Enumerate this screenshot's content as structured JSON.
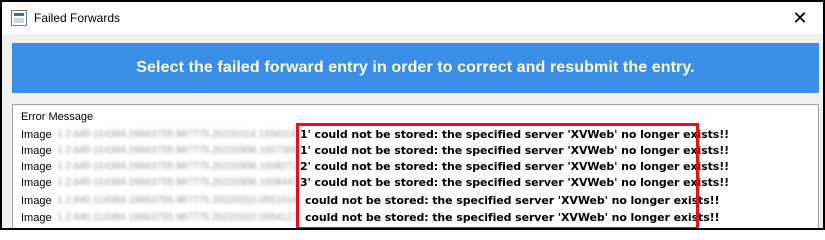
{
  "window": {
    "title": "Failed Forwards",
    "close_glyph": "✕"
  },
  "banner": {
    "text": "Select the failed forward entry in order to correct and resubmit the entry."
  },
  "list": {
    "column_header": "Error Message",
    "rows": [
      {
        "prefix": "Image",
        "uid": "1.2.840.114384.16663755.987775.20220114.1334116",
        "message": "1' could not be stored: the specified server 'XVWeb' no longer exists!!"
      },
      {
        "prefix": "Image",
        "uid": "1.2.840.114384.16663755.987775.20220306.1607369",
        "message": "1' could not be stored: the specified server 'XVWeb' no longer exists!!"
      },
      {
        "prefix": "Image",
        "uid": "1.2.840.114384.16663755.987775.20220306.1608272",
        "message": "2' could not be stored: the specified server 'XVWeb' no longer exists!!"
      },
      {
        "prefix": "Image",
        "uid": "1.2.840.114384.16663755.987775.20220306.1608443",
        "message": "3' could not be stored: the specified server 'XVWeb' no longer exists!!"
      },
      {
        "prefix": "Image",
        "uid": "1.2.840.114384.16663755.987775.20220310.0551018",
        "message": "could not be stored: the specified server 'XVWeb' no longer exists!!"
      },
      {
        "prefix": "Image",
        "uid": "1.2.840.114384.16663755.987775.20220310.0554127",
        "message": "could not be stored: the specified server 'XVWeb' no longer exists!!"
      }
    ]
  },
  "colors": {
    "banner": "#3a8ee6",
    "highlight": "#e3101e"
  }
}
